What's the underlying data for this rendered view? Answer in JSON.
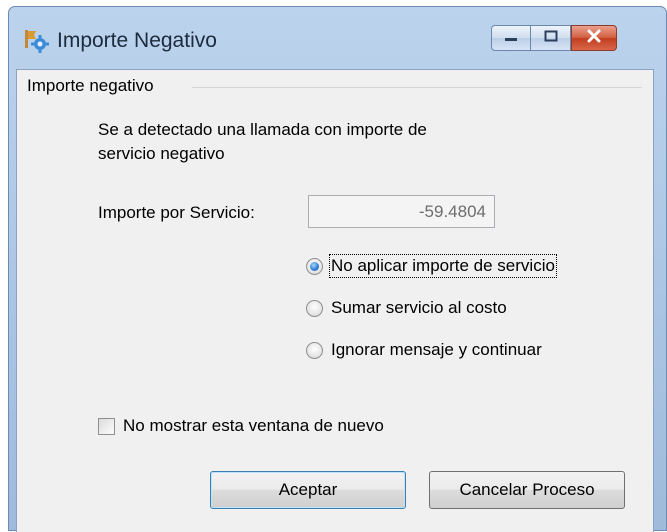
{
  "window": {
    "title": "Importe Negativo",
    "app_icon": "gear-flag-icon",
    "controls": {
      "minimize": "minimize-icon",
      "maximize": "maximize-icon",
      "close": "close-icon"
    }
  },
  "group": {
    "legend": "Importe negativo"
  },
  "message": {
    "line1": "Se a detectado una llamada con importe de",
    "line2": "servicio negativo"
  },
  "field": {
    "label": "Importe por Servicio:",
    "value": "-59.4804"
  },
  "options": [
    {
      "label": "No aplicar importe de servicio",
      "checked": true
    },
    {
      "label": "Sumar servicio al costo",
      "checked": false
    },
    {
      "label": "Ignorar mensaje y continuar",
      "checked": false
    }
  ],
  "checkbox": {
    "label": "No mostrar esta ventana de nuevo",
    "checked": false
  },
  "buttons": {
    "accept": "Aceptar",
    "cancel": "Cancelar Proceso"
  },
  "colors": {
    "title_bar": "#a9c4e3",
    "dialog_bg": "#f0f0f0",
    "close_button": "#c23e1f",
    "radio_selected": "#2b7bd1"
  }
}
